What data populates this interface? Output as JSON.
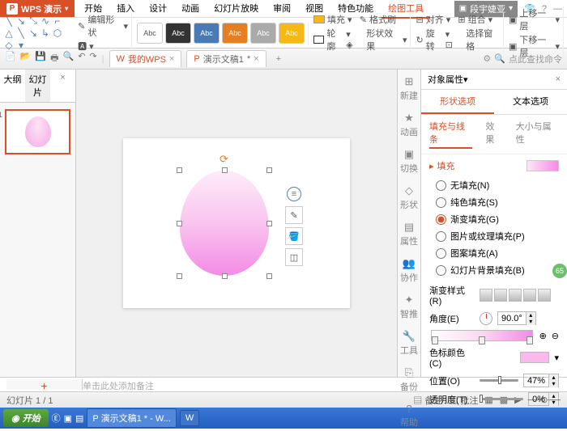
{
  "app": {
    "name": "WPS 演示",
    "user": "段宇婕亚"
  },
  "menu": {
    "items": [
      "开始",
      "插入",
      "设计",
      "动画",
      "幻灯片放映",
      "审阅",
      "视图",
      "特色功能"
    ],
    "active": "绘图工具"
  },
  "ribbon": {
    "editShape": "编辑形状",
    "styleLabel": "Abc",
    "fill": "填充",
    "fmtPainter": "格式刷",
    "outline": "轮廓",
    "shapeFx": "形状效果",
    "align": "对齐",
    "group": "组合",
    "rotate": "旋转",
    "selPane": "选择窗格",
    "moveUp": "上移一层",
    "moveDown": "下移一层"
  },
  "tabs": {
    "home": "我的WPS",
    "doc": "演示文稿1",
    "star": "*"
  },
  "search": {
    "placeholder": "点此查找命令"
  },
  "leftPanel": {
    "tab1": "大纲",
    "tab2": "幻灯片",
    "thumbIndex": "1"
  },
  "rail": {
    "items": [
      "新建",
      "动画",
      "切换",
      "形状",
      "属性",
      "协作",
      "智推",
      "工具",
      "备份",
      "帮助"
    ]
  },
  "prop": {
    "title": "对象属性",
    "tab1": "形状选项",
    "tab2": "文本选项",
    "sub1": "填充与线条",
    "sub2": "效果",
    "sub3": "大小与属性",
    "fillHeader": "填充",
    "radios": {
      "none": "无填充(N)",
      "solid": "纯色填充(S)",
      "gradient": "渐变填充(G)",
      "picture": "图片或纹理填充(P)",
      "pattern": "图案填充(A)",
      "slidebg": "幻灯片背景填充(B)"
    },
    "gradStyle": "渐变样式(R)",
    "angle": "角度(E)",
    "angleVal": "90.0°",
    "stopColor": "色标颜色(C)",
    "position": "位置(O)",
    "posVal": "47%",
    "transparency": "透明度(T)",
    "transVal": "0%"
  },
  "notes": {
    "placeholder": "单击此处添加备注"
  },
  "status": {
    "slideInfo": "幻灯片 1 / 1",
    "noteBtn": "备注",
    "commentBtn": "批注"
  },
  "taskbar": {
    "start": "开始",
    "active": "演示文稿1 * - W...",
    "btn2": "W"
  }
}
